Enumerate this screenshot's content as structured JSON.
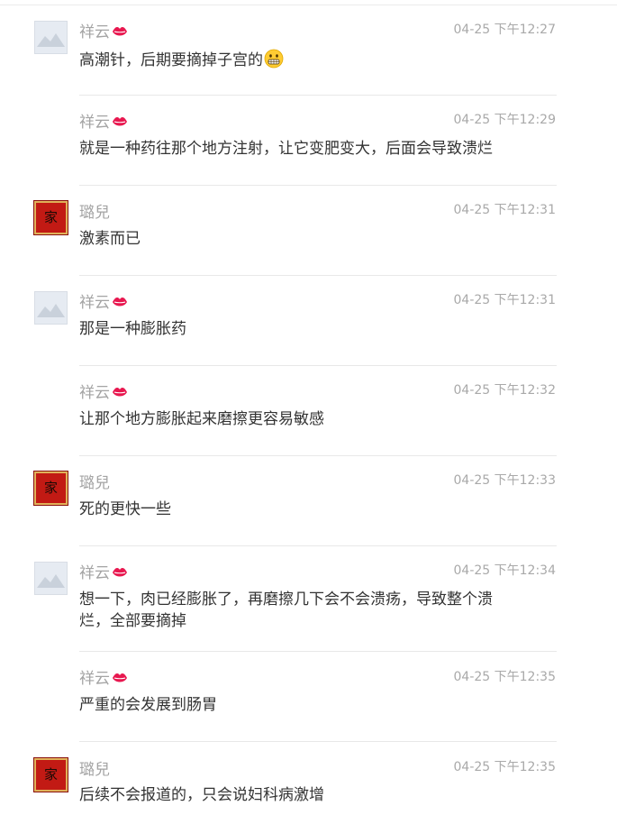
{
  "comments": [
    {
      "user": "祥云",
      "avatar": "landscape-placeholder",
      "badge": "lips-emoji",
      "time": "04-25 下午12:27",
      "text": "高潮针，后期要摘掉子宫的",
      "emoji": "grimacing-face-emoji"
    },
    {
      "user": "祥云",
      "avatar": "",
      "badge": "lips-emoji",
      "time": "04-25 下午12:29",
      "text": "就是一种药往那个地方注射，让它变肥变大，后面会导致溃烂"
    },
    {
      "user": "璐兒",
      "avatar": "red-seal",
      "seal_char": "家",
      "time": "04-25 下午12:31",
      "text": "激素而已"
    },
    {
      "user": "祥云",
      "avatar": "landscape-placeholder",
      "badge": "lips-emoji",
      "time": "04-25 下午12:31",
      "text": "那是一种膨胀药"
    },
    {
      "user": "祥云",
      "avatar": "",
      "badge": "lips-emoji",
      "time": "04-25 下午12:32",
      "text": "让那个地方膨胀起来磨擦更容易敏感"
    },
    {
      "user": "璐兒",
      "avatar": "red-seal",
      "seal_char": "家",
      "time": "04-25 下午12:33",
      "text": "死的更快一些"
    },
    {
      "user": "祥云",
      "avatar": "landscape-placeholder",
      "badge": "lips-emoji",
      "time": "04-25 下午12:34",
      "text": "想一下，肉已经膨胀了，再磨擦几下会不会溃疡，导致整个溃烂，全部要摘掉"
    },
    {
      "user": "祥云",
      "avatar": "",
      "badge": "lips-emoji",
      "time": "04-25 下午12:35",
      "text": "严重的会发展到肠胃"
    },
    {
      "user": "璐兒",
      "avatar": "red-seal",
      "seal_char": "家",
      "time": "04-25 下午12:35",
      "text": "后续不会报道的，只会说妇科病激增"
    }
  ],
  "colors": {
    "username": "#a4a4a4",
    "timestamp": "#a9a9a9",
    "body_text": "#333333",
    "seal_red": "#c21a14",
    "divider": "#e8e8e8"
  }
}
